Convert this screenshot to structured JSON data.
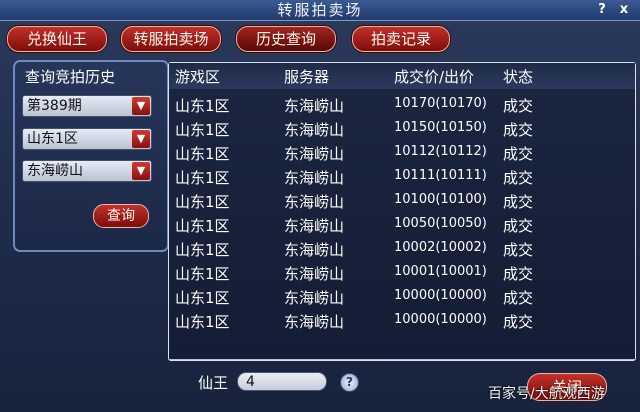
{
  "window": {
    "title": "转服拍卖场",
    "help_icon": "?",
    "close_icon": "x"
  },
  "tabs": [
    {
      "label": "兑换仙王"
    },
    {
      "label": "转服拍卖场"
    },
    {
      "label": "历史查询"
    },
    {
      "label": "拍卖记录"
    }
  ],
  "query_panel": {
    "title": "查询竞拍历史",
    "selects": [
      {
        "value": "第389期"
      },
      {
        "value": "山东1区"
      },
      {
        "value": "东海崂山"
      }
    ],
    "query_button": "查询"
  },
  "table": {
    "headers": [
      "游戏区",
      "服务器",
      "成交价/出价",
      "状态"
    ],
    "rows": [
      {
        "zone": "山东1区",
        "server": "东海崂山",
        "price": "10170(10170)",
        "status": "成交"
      },
      {
        "zone": "山东1区",
        "server": "东海崂山",
        "price": "10150(10150)",
        "status": "成交"
      },
      {
        "zone": "山东1区",
        "server": "东海崂山",
        "price": "10112(10112)",
        "status": "成交"
      },
      {
        "zone": "山东1区",
        "server": "东海崂山",
        "price": "10111(10111)",
        "status": "成交"
      },
      {
        "zone": "山东1区",
        "server": "东海崂山",
        "price": "10100(10100)",
        "status": "成交"
      },
      {
        "zone": "山东1区",
        "server": "东海崂山",
        "price": "10050(10050)",
        "status": "成交"
      },
      {
        "zone": "山东1区",
        "server": "东海崂山",
        "price": "10002(10002)",
        "status": "成交"
      },
      {
        "zone": "山东1区",
        "server": "东海崂山",
        "price": "10001(10001)",
        "status": "成交"
      },
      {
        "zone": "山东1区",
        "server": "东海崂山",
        "price": "10000(10000)",
        "status": "成交"
      },
      {
        "zone": "山东1区",
        "server": "东海崂山",
        "price": "10000(10000)",
        "status": "成交"
      }
    ]
  },
  "footer": {
    "label": "仙王",
    "value": "4",
    "help_icon": "?",
    "close_button": "关闭"
  },
  "watermark": "百家号/大航观西游",
  "colors": {
    "accent_red": "#c2302a",
    "panel_border": "#6f88bd"
  }
}
